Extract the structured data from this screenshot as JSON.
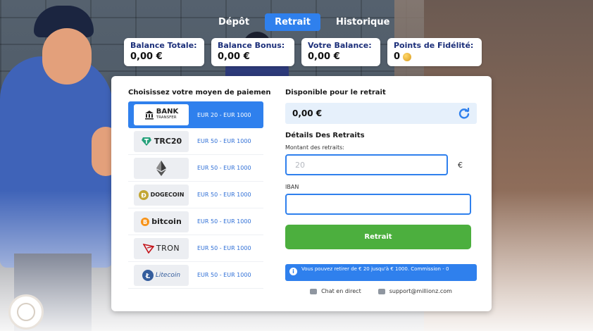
{
  "tabs": [
    {
      "label": "Dépôt",
      "active": false
    },
    {
      "label": "Retrait",
      "active": true
    },
    {
      "label": "Historique",
      "active": false
    }
  ],
  "balances": {
    "total": {
      "label": "Balance Totale:",
      "value": "0,00 €"
    },
    "bonus": {
      "label": "Balance Bonus:",
      "value": "0,00 €"
    },
    "yours": {
      "label": "Votre Balance:",
      "value": "0,00 €"
    },
    "loyalty": {
      "label": "Points de Fidélité:",
      "value": "0",
      "icon": "coin-icon"
    }
  },
  "methods": {
    "title": "Choisissez votre moyen de paiemen",
    "items": [
      {
        "logo": "BANK",
        "logo_sub": "TRANSFER",
        "range": "EUR 20 - EUR 1000",
        "active": true,
        "icon": "bank-icon"
      },
      {
        "logo": "TRC20",
        "logo_sub": "",
        "range": "EUR 50 - EUR 1000",
        "active": false,
        "icon": "tether-icon"
      },
      {
        "logo": "",
        "logo_sub": "",
        "range": "EUR 50 - EUR 1000",
        "active": false,
        "icon": "ethereum-icon"
      },
      {
        "logo": "DOGECOIN",
        "logo_sub": "",
        "range": "EUR 50 - EUR 1000",
        "active": false,
        "icon": "dogecoin-icon"
      },
      {
        "logo": "bitcoin",
        "logo_sub": "",
        "range": "EUR 50 - EUR 1000",
        "active": false,
        "icon": "bitcoin-icon"
      },
      {
        "logo": "TRON",
        "logo_sub": "",
        "range": "EUR 50 - EUR 1000",
        "active": false,
        "icon": "tron-icon"
      },
      {
        "logo": "Litecoin",
        "logo_sub": "",
        "range": "EUR 50 - EUR 1000",
        "active": false,
        "icon": "litecoin-icon"
      }
    ]
  },
  "withdraw": {
    "available_title": "Disponible pour le retrait",
    "available_value": "0,00 €",
    "details_title": "Détails Des Retraits",
    "amount_label": "Montant des retraits:",
    "amount_placeholder": "20",
    "currency": "€",
    "iban_label": "IBAN",
    "iban_value": "",
    "submit_label": "Retrait",
    "info_text": "Vous pouvez retirer de € 20 jusqu'à € 1000. Commission - 0",
    "chat_label": "Chat en direct",
    "support_email": "support@millionz.com"
  },
  "colors": {
    "accent": "#2f80ed",
    "success": "#4caf3e",
    "navy": "#1c2f7a"
  }
}
